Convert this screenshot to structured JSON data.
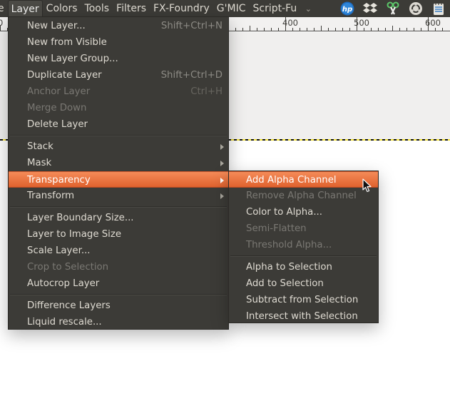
{
  "menubar": {
    "items": [
      {
        "label": "e",
        "partial": true
      },
      {
        "label": "Layer",
        "active": true
      },
      {
        "label": "Colors"
      },
      {
        "label": "Tools"
      },
      {
        "label": "Filters"
      },
      {
        "label": "FX-Foundry"
      },
      {
        "label": "G'MIC"
      },
      {
        "label": "Script-Fu"
      }
    ],
    "overflow_icon": "chevron-down-icon",
    "tray_icons": [
      "hp-icon",
      "dropbox-icon",
      "scissors-icon",
      "ubuntu-one-icon",
      "notes-icon"
    ]
  },
  "ruler": {
    "labels": [
      "0",
      "400",
      "500",
      "600"
    ]
  },
  "layer_menu": {
    "groups": [
      [
        {
          "label": "New Layer...",
          "accel": "Shift+Ctrl+N"
        },
        {
          "label": "New from Visible"
        },
        {
          "label": "New Layer Group..."
        },
        {
          "label": "Duplicate Layer",
          "accel": "Shift+Ctrl+D"
        },
        {
          "label": "Anchor Layer",
          "accel": "Ctrl+H",
          "disabled": true
        },
        {
          "label": "Merge Down",
          "disabled": true
        },
        {
          "label": "Delete Layer"
        }
      ],
      [
        {
          "label": "Stack",
          "submenu": true
        },
        {
          "label": "Mask",
          "submenu": true
        },
        {
          "label": "Transparency",
          "submenu": true,
          "highlighted": true
        },
        {
          "label": "Transform",
          "submenu": true
        }
      ],
      [
        {
          "label": "Layer Boundary Size..."
        },
        {
          "label": "Layer to Image Size"
        },
        {
          "label": "Scale Layer..."
        },
        {
          "label": "Crop to Selection",
          "disabled": true
        },
        {
          "label": "Autocrop Layer"
        }
      ],
      [
        {
          "label": "Difference Layers"
        },
        {
          "label": "Liquid rescale..."
        }
      ]
    ]
  },
  "transparency_menu": {
    "groups": [
      [
        {
          "label": "Add Alpha Channel",
          "highlighted": true
        },
        {
          "label": "Remove Alpha Channel",
          "disabled": true
        },
        {
          "label": "Color to Alpha..."
        },
        {
          "label": "Semi-Flatten",
          "disabled": true
        },
        {
          "label": "Threshold Alpha...",
          "disabled": true
        }
      ],
      [
        {
          "label": "Alpha to Selection"
        },
        {
          "label": "Add to Selection"
        },
        {
          "label": "Subtract from Selection"
        },
        {
          "label": "Intersect with Selection"
        }
      ]
    ]
  },
  "colors": {
    "menu_bg": "#3c3b37",
    "highlight": "#e9703f",
    "text": "#dfdbd2",
    "disabled_text": "#7a7873"
  }
}
